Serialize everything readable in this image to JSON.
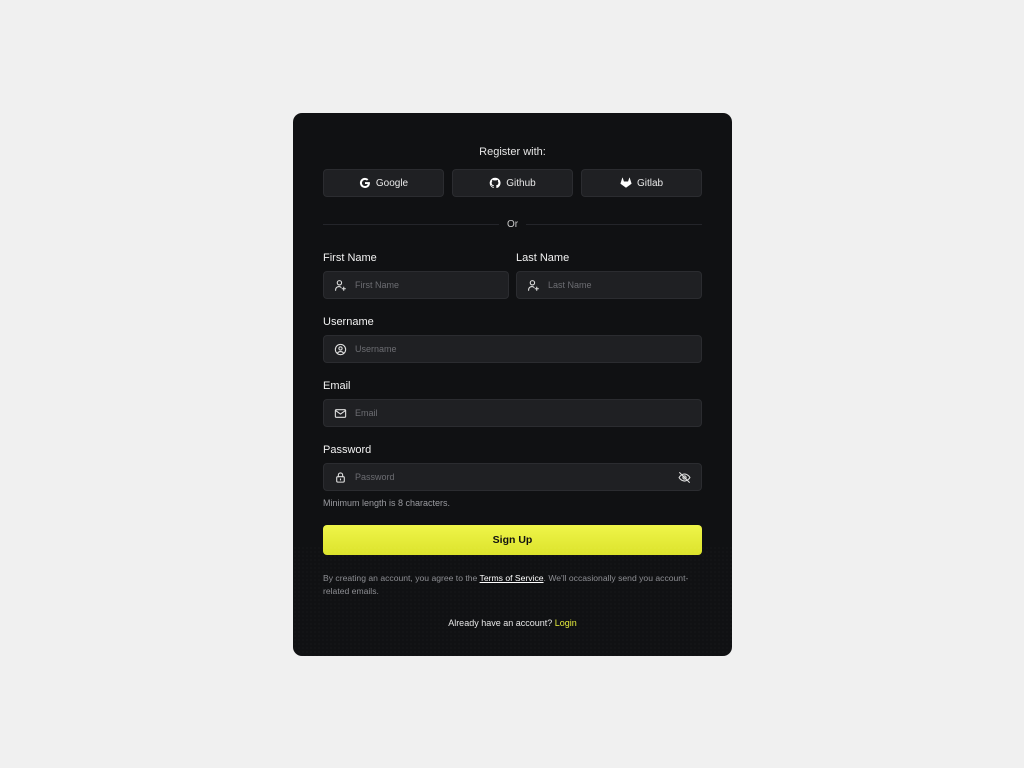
{
  "register": {
    "title": "Register with:",
    "providers": [
      {
        "label": "Google",
        "icon": "google-icon"
      },
      {
        "label": "Github",
        "icon": "github-icon"
      },
      {
        "label": "Gitlab",
        "icon": "gitlab-icon"
      }
    ],
    "divider_label": "Or"
  },
  "form": {
    "first_name": {
      "label": "First Name",
      "placeholder": "First Name",
      "icon": "user-plus-icon"
    },
    "last_name": {
      "label": "Last Name",
      "placeholder": "Last Name",
      "icon": "user-plus-icon"
    },
    "username": {
      "label": "Username",
      "placeholder": "Username",
      "icon": "user-circle-icon"
    },
    "email": {
      "label": "Email",
      "placeholder": "Email",
      "icon": "mail-icon"
    },
    "password": {
      "label": "Password",
      "placeholder": "Password",
      "icon": "lock-icon",
      "toggle_icon": "eye-off-icon"
    },
    "password_hint": "Minimum length is 8 characters.",
    "submit_label": "Sign Up"
  },
  "terms": {
    "prefix": "By creating an account, you agree to the ",
    "link_text": "Terms of Service",
    "suffix": ". We'll occasionally send you account-related emails."
  },
  "login": {
    "prompt": "Already have an account? ",
    "link_text": "Login"
  },
  "colors": {
    "page_background": "#f0f0f0",
    "card_background": "#101113",
    "field_background": "#1f2023",
    "accent": "#e6ec3c"
  }
}
